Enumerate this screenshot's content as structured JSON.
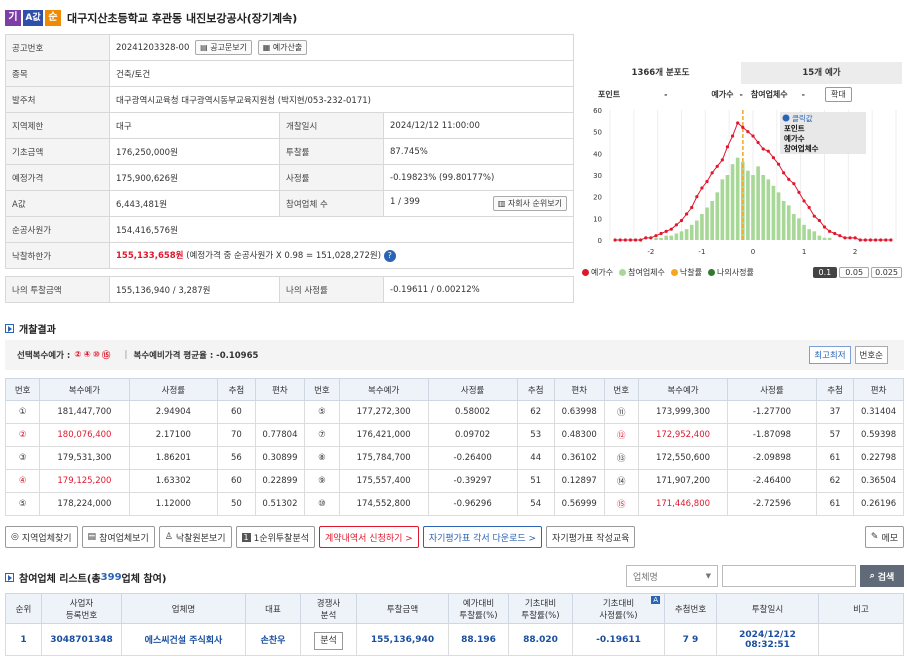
{
  "header": {
    "badges": [
      {
        "label": "기",
        "color": "#7b3fa6"
      },
      {
        "label": "A값",
        "color": "#2f4fa8"
      },
      {
        "label": "순",
        "color": "#f08a00"
      }
    ],
    "title": "대구지산초등학교 후관동 내진보강공사(장기계속)"
  },
  "info": {
    "notice_label": "공고번호",
    "notice_value": "20241203328-00",
    "notice_btn": "공고문보기",
    "price_btn": "예가산출",
    "type_label": "종목",
    "type_value": "건축/토건",
    "client_label": "발주처",
    "client_value": "대구광역시교육청 대구광역시동부교육지원청 (박지현/053-232-0171)",
    "region_label": "지역제한",
    "region_value": "대구",
    "open_label": "개찰일시",
    "open_value": "2024/12/12 11:00:00",
    "base_label": "기초금액",
    "base_value": "176,250,000원",
    "rate_label": "투찰률",
    "rate_value": "87.745%",
    "est_label": "예정가격",
    "est_value": "175,900,626원",
    "srate_label": "사정률",
    "srate_value": "-0.19823% (99.80177%)",
    "a_label": "A값",
    "a_value": "6,443,481원",
    "count_label": "참여업체 수",
    "count_value": "1 / 399",
    "rank_btn": "자회사 순위보기",
    "net_label": "순공사원가",
    "net_value": "154,416,576원",
    "low_label": "낙찰하한가",
    "low_value": "155,133,658원",
    "low_note": "(예정가격 중 순공사원가 X 0.98 = 151,028,272원)",
    "my_label": "나의 투찰금액",
    "my_value": "155,136,940 / 3,287원",
    "mysr_label": "나의 사정률",
    "mysr_value": "-0.19611 / 0.00212%"
  },
  "chart_panel": {
    "tab1": "1366개 분포도",
    "tab2": "15개 예가",
    "point_label": "포인트",
    "point_value": "-",
    "pricenum_label": "예가수",
    "pricenum_value": "-",
    "partnum_label": "참여업체수",
    "partnum_value": "-",
    "zoom_btn": "확대",
    "tooltip": {
      "title": "클릭값",
      "l1": "포인트",
      "l2": "예가수",
      "l3": "참여업체수"
    },
    "legend": {
      "a": "예가수",
      "b": "참여업체수",
      "c": "낙찰률",
      "d": "나의사정률"
    },
    "scale_btns": [
      "0.1",
      "0.05",
      "0.025"
    ]
  },
  "chart_data": {
    "type": "bar",
    "xlim": [
      -2.8,
      2.8
    ],
    "ylim": [
      0,
      60
    ],
    "xticks": [
      "-2",
      "-1",
      "0",
      "1",
      "2"
    ],
    "yticks": [
      "0",
      "10",
      "20",
      "30",
      "40",
      "50",
      "60"
    ],
    "x": [
      -2.7,
      -2.6,
      -2.5,
      -2.4,
      -2.3,
      -2.2,
      -2.1,
      -2.0,
      -1.9,
      -1.8,
      -1.7,
      -1.6,
      -1.5,
      -1.4,
      -1.3,
      -1.2,
      -1.1,
      -1.0,
      -0.9,
      -0.8,
      -0.7,
      -0.6,
      -0.5,
      -0.4,
      -0.3,
      -0.2,
      -0.1,
      0.0,
      0.1,
      0.2,
      0.3,
      0.4,
      0.5,
      0.6,
      0.7,
      0.8,
      0.9,
      1.0,
      1.1,
      1.2,
      1.3,
      1.4,
      1.5,
      1.6,
      1.7,
      1.8,
      1.9,
      2.0,
      2.1,
      2.2,
      2.3,
      2.4,
      2.5,
      2.6,
      2.7
    ],
    "series": [
      {
        "name": "예가수",
        "color": "#e0182d",
        "values": [
          0,
          0,
          0,
          0,
          0,
          0,
          1,
          1,
          2,
          3,
          4,
          5,
          7,
          9,
          12,
          15,
          20,
          24,
          27,
          31,
          34,
          37,
          43,
          48,
          54,
          52,
          50,
          48,
          45,
          42,
          41,
          38,
          35,
          31,
          28,
          26,
          22,
          18,
          15,
          11,
          9,
          6,
          4,
          3,
          2,
          1,
          1,
          1,
          0,
          0,
          0,
          0,
          0,
          0,
          0
        ]
      },
      {
        "name": "참여업체수",
        "color": "#a8d898",
        "values": [
          0,
          0,
          0,
          0,
          0,
          0,
          0,
          0,
          1,
          1,
          2,
          2,
          3,
          4,
          5,
          7,
          9,
          12,
          15,
          18,
          22,
          28,
          30,
          35,
          38,
          36,
          32,
          30,
          34,
          30,
          28,
          25,
          22,
          18,
          16,
          12,
          10,
          7,
          5,
          4,
          2,
          1,
          1,
          0,
          0,
          0,
          0,
          0,
          0,
          0,
          0,
          0,
          0,
          0,
          0
        ]
      }
    ],
    "marker_x": -0.198
  },
  "results": {
    "title": "개찰결과",
    "choice_label": "선택복수예가 :",
    "choice_nums": [
      "②",
      "④",
      "⑩",
      "⑮"
    ],
    "avg_label": "복수예비가격 평균율 : -0.10965",
    "sort_btn1": "최고최저",
    "sort_btn2": "번호순",
    "headers": [
      "번호",
      "복수예가",
      "사정률",
      "추첨",
      "편차"
    ],
    "rows": [
      [
        {
          "n": "①",
          "p": "181,447,700",
          "r": "2.94904",
          "c": "60",
          "d": "",
          "red": false
        },
        {
          "n": "⑤",
          "p": "177,272,300",
          "r": "0.58002",
          "c": "62",
          "d": "0.63998",
          "red": false
        },
        {
          "n": "⑪",
          "p": "173,999,300",
          "r": "-1.27700",
          "c": "37",
          "d": "0.31404",
          "red": false
        }
      ],
      [
        {
          "n": "②",
          "p": "180,076,400",
          "r": "2.17100",
          "c": "70",
          "d": "0.77804",
          "red": true
        },
        {
          "n": "⑦",
          "p": "176,421,000",
          "r": "0.09702",
          "c": "53",
          "d": "0.48300",
          "red": false
        },
        {
          "n": "⑫",
          "p": "172,952,400",
          "r": "-1.87098",
          "c": "57",
          "d": "0.59398",
          "red": true
        }
      ],
      [
        {
          "n": "③",
          "p": "179,531,300",
          "r": "1.86201",
          "c": "56",
          "d": "0.30899",
          "red": false
        },
        {
          "n": "⑧",
          "p": "175,784,700",
          "r": "-0.26400",
          "c": "44",
          "d": "0.36102",
          "red": false
        },
        {
          "n": "⑬",
          "p": "172,550,600",
          "r": "-2.09898",
          "c": "61",
          "d": "0.22798",
          "red": false
        }
      ],
      [
        {
          "n": "④",
          "p": "179,125,200",
          "r": "1.63302",
          "c": "60",
          "d": "0.22899",
          "red": true
        },
        {
          "n": "⑨",
          "p": "175,557,400",
          "r": "-0.39297",
          "c": "51",
          "d": "0.12897",
          "red": false
        },
        {
          "n": "⑭",
          "p": "171,907,200",
          "r": "-2.46400",
          "c": "62",
          "d": "0.36504",
          "red": false
        }
      ],
      [
        {
          "n": "⑤",
          "p": "178,224,000",
          "r": "1.12000",
          "c": "50",
          "d": "0.51302",
          "red": false
        },
        {
          "n": "⑩",
          "p": "174,552,800",
          "r": "-0.96296",
          "c": "54",
          "d": "0.56999",
          "red": false
        },
        {
          "n": "⑮",
          "p": "171,446,800",
          "r": "-2.72596",
          "c": "61",
          "d": "0.26196",
          "red": true
        }
      ]
    ]
  },
  "actions": {
    "b1": "지역업체찾기",
    "b2": "참여업체보기",
    "b3": "낙찰원본보기",
    "b4": "1순위투찰분석",
    "b5": "계약내역서 신청하기 >",
    "b6": "자기평가표 각서 다운로드 >",
    "b7": "자기평가표 작성교육",
    "b8": "메모"
  },
  "plist": {
    "title_pre": "참여업체 리스트(총 ",
    "title_count": "399",
    "title_post": " 업체 참여)",
    "search_select": "업체명",
    "search_btn": "검색",
    "headers": [
      "순위",
      "사업자\n등록번호",
      "업체명",
      "대표",
      "경쟁사\n분석",
      "투찰금액",
      "예가대비\n투찰률(%)",
      "기초대비\n투찰률(%)",
      "기초대비\n사정률(%)",
      "추첨번호",
      "투찰일시",
      "비고"
    ],
    "row": {
      "rank": "1",
      "biz": "3048701348",
      "name": "에스씨건설 주식회사",
      "rep": "손찬우",
      "analysis": "분석",
      "amount": "155,136,940",
      "r1": "88.196",
      "r2": "88.020",
      "r3": "-0.19611",
      "draw": "7 9",
      "date": "2024/12/12",
      "time": "08:32:51",
      "note": ""
    }
  }
}
